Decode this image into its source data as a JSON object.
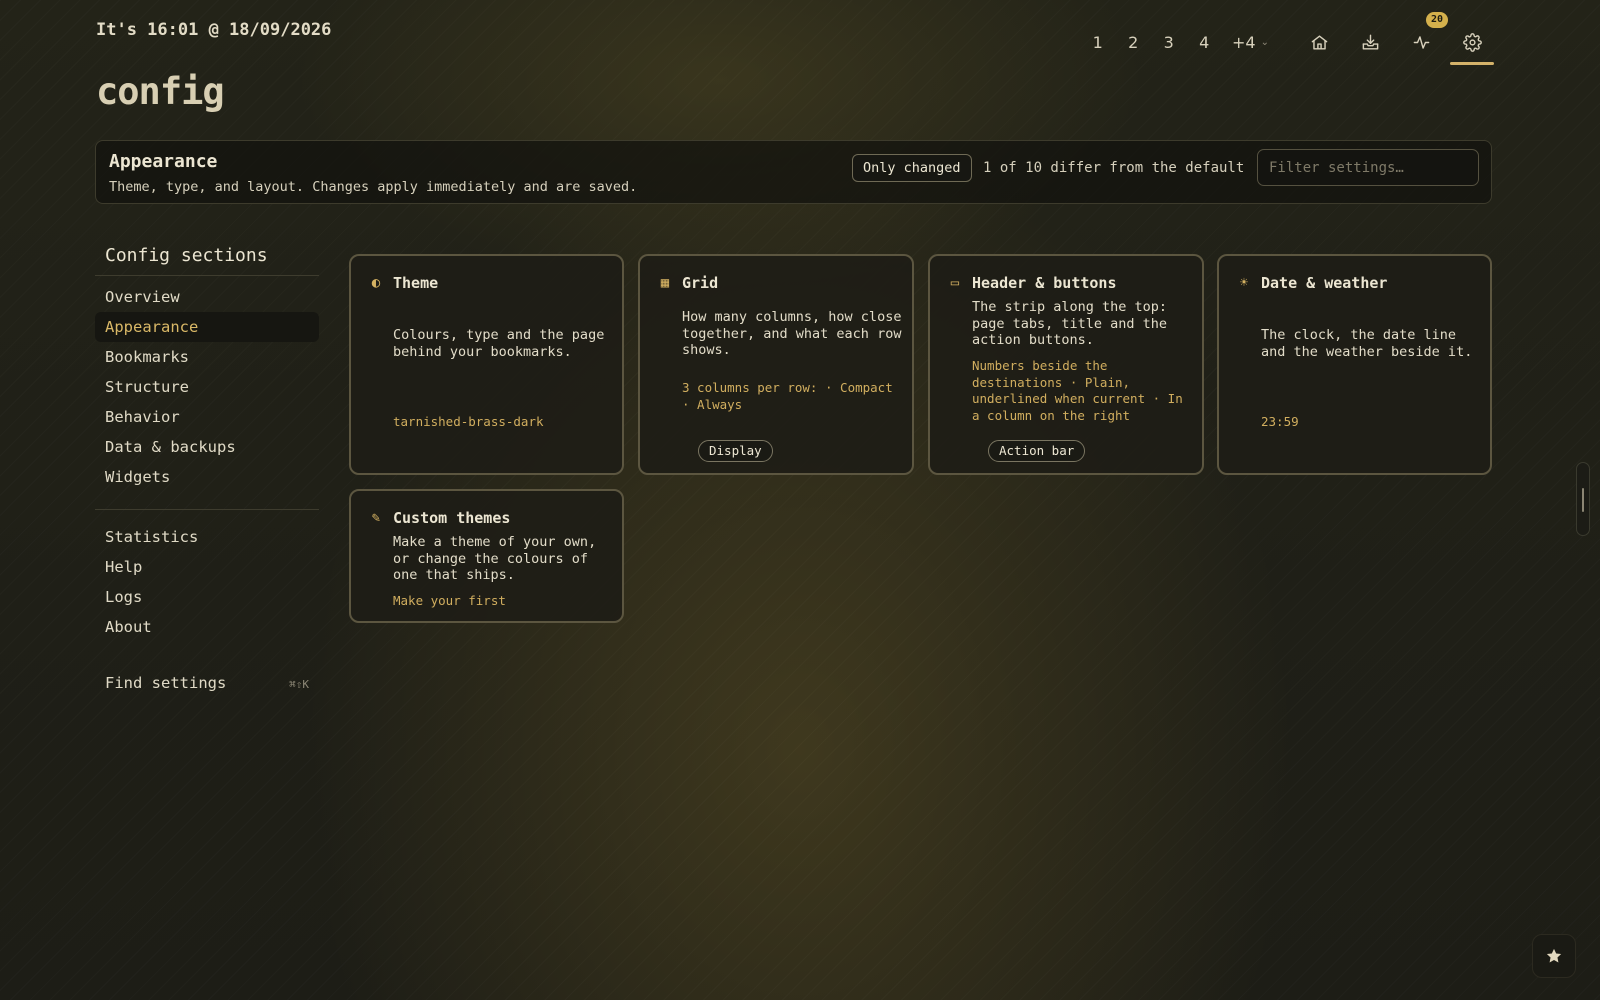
{
  "header": {
    "clock": "It's 16:01 @ 18/09/2026",
    "page_title": "config"
  },
  "nav": {
    "tabs": [
      "1",
      "2",
      "3",
      "4"
    ],
    "more_label": "+4",
    "notification_count": "20",
    "icons": [
      "home-icon",
      "inbox-download-icon",
      "activity-icon",
      "gear-icon"
    ],
    "active_icon": "gear-icon"
  },
  "section": {
    "title": "Appearance",
    "description": "Theme, type, and layout. Changes apply immediately and are saved.",
    "only_changed_label": "Only changed",
    "diff_status": "1 of 10 differ from the default",
    "filter_placeholder": "Filter settings…"
  },
  "sidebar": {
    "heading": "Config sections",
    "primary": [
      "Overview",
      "Appearance",
      "Bookmarks",
      "Structure",
      "Behavior",
      "Data & backups",
      "Widgets"
    ],
    "active": "Appearance",
    "secondary": [
      "Statistics",
      "Help",
      "Logs",
      "About"
    ],
    "find_label": "Find settings",
    "find_shortcut": "⌘⇧K"
  },
  "cards": {
    "theme": {
      "title": "Theme",
      "description": "Colours, type and the page behind your bookmarks.",
      "value": "tarnished-brass-dark"
    },
    "grid": {
      "title": "Grid",
      "description": "How many columns, how close together, and what each row shows.",
      "value": "3 columns per row: · Compact · Always",
      "pill": "Display"
    },
    "header_buttons": {
      "title": "Header & buttons",
      "description": "The strip along the top: page tabs, title and the action buttons.",
      "value": "Numbers beside the destinations · Plain, underlined when current · In a column on the right",
      "pill": "Action bar"
    },
    "date_weather": {
      "title": "Date & weather",
      "description": "The clock, the date line and the weather beside it.",
      "value": "23:59"
    },
    "custom_themes": {
      "title": "Custom themes",
      "description": "Make a theme of your own, or change the colours of one that ships.",
      "value": "Make your first"
    }
  },
  "colors": {
    "accent": "#d4b26a",
    "background": "#202018",
    "card_border": "#5c5640"
  }
}
